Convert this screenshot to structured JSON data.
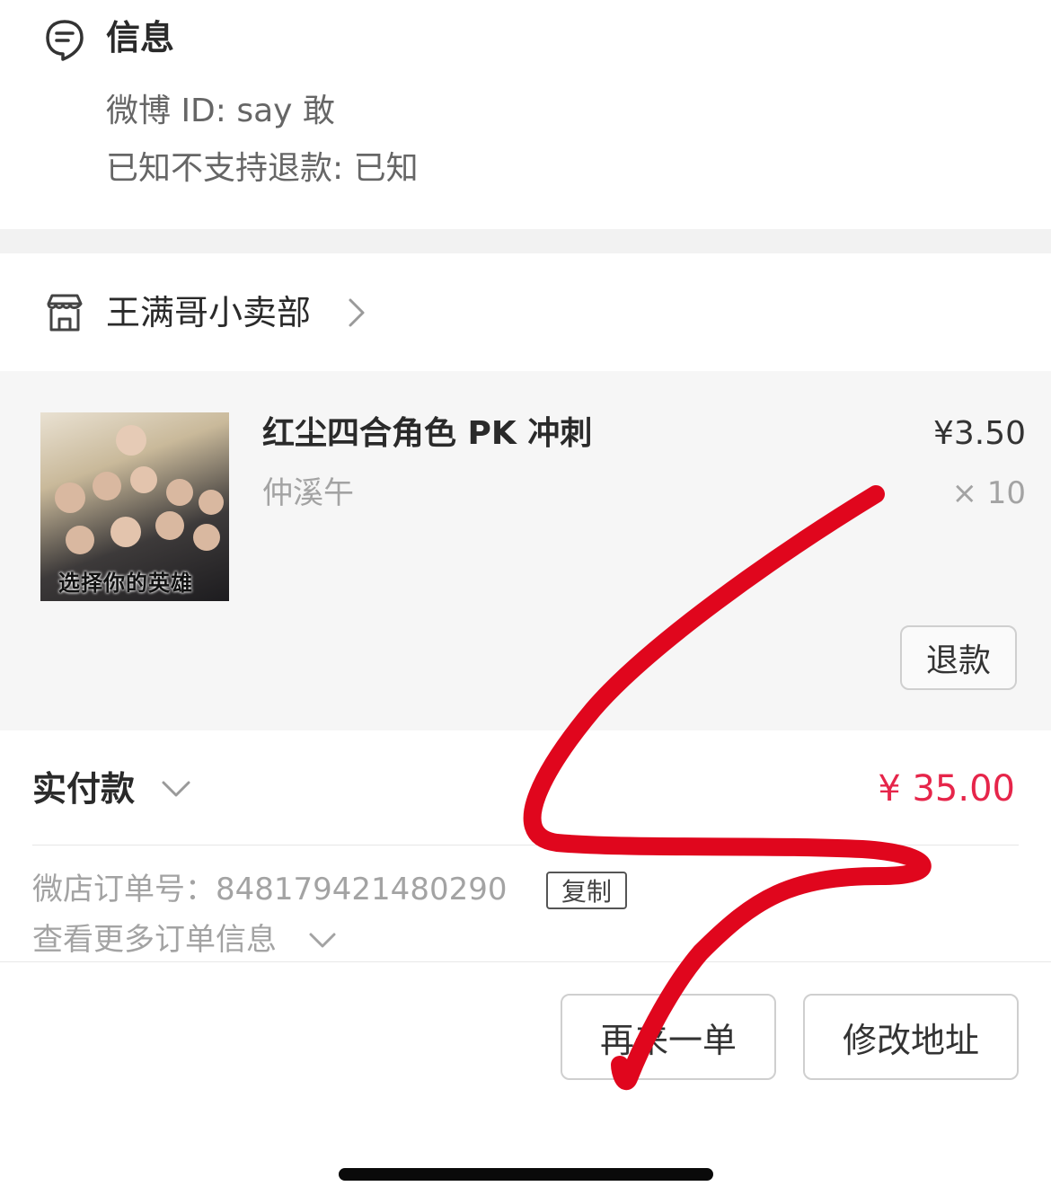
{
  "info": {
    "title": "信息",
    "icon": "message-note-icon",
    "weibo_id_line": "微博 ID: say 敢",
    "refund_notice_line": "已知不支持退款: 已知"
  },
  "shop": {
    "icon": "store-icon",
    "name": "王满哥小卖部"
  },
  "product": {
    "name": "红尘四合角色 PK 冲刺",
    "variant": "仲溪午",
    "price": "¥3.50",
    "quantity": "× 10",
    "image_caption": "选择你的英雄",
    "refund_label": "退款"
  },
  "payment": {
    "label": "实付款",
    "amount": "¥ 35.00",
    "amount_color": "#e6254a"
  },
  "order": {
    "number_line": "微店订单号：848179421480290",
    "copy_label": "复制",
    "more_info_label": "查看更多订单信息"
  },
  "actions": {
    "reorder_label": "再来一单",
    "edit_address_label": "修改地址"
  },
  "annotation": {
    "scribble_color": "#e0061d"
  }
}
